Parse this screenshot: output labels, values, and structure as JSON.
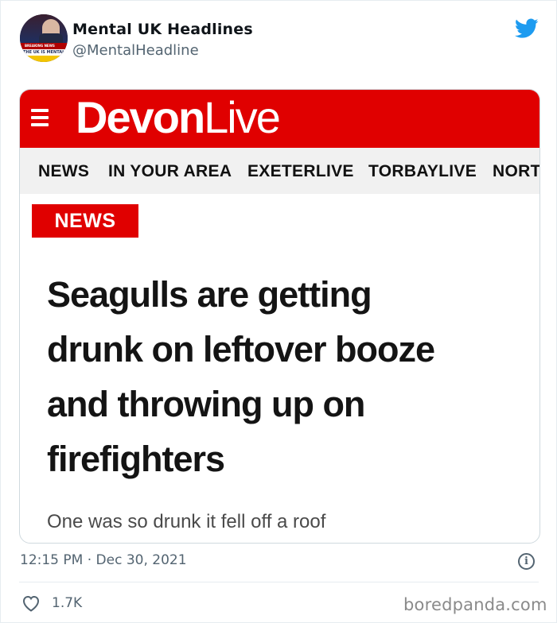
{
  "tweet": {
    "author_name": "Mental UK Headlines",
    "author_handle": "@MentalHeadline",
    "avatar_texts": [
      "BREAKING NEWS",
      "THE UK IS MENTAL"
    ],
    "timestamp": "12:15 PM · Dec 30, 2021",
    "like_count": "1.7K",
    "twitter_blue": "#1d9bf0"
  },
  "article": {
    "brand_bold": "Devon",
    "brand_light": "Live",
    "brand_color": "#e00000",
    "nav": [
      "NEWS",
      "IN YOUR AREA",
      "EXETERLIVE",
      "TORBAYLIVE",
      "NORT"
    ],
    "section_tag": "NEWS",
    "headline_lines": [
      "Seagulls are getting",
      "drunk on leftover booze",
      "and throwing up on",
      "firefighters"
    ],
    "standfirst": "One was so drunk it fell off a roof"
  },
  "watermark": "boredpanda.com",
  "icons": [
    "twitter-bird-icon",
    "hamburger-menu-icon",
    "info-icon",
    "heart-icon"
  ]
}
